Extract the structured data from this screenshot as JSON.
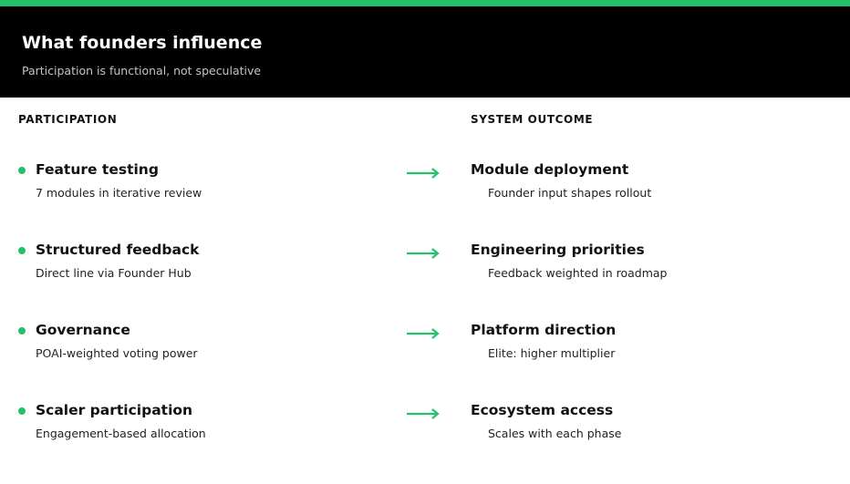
{
  "header": {
    "title": "What founders influence",
    "subtitle": "Participation is functional, not speculative"
  },
  "columns": {
    "left": "PARTICIPATION",
    "right": "SYSTEM OUTCOME"
  },
  "rows": [
    {
      "title": "Feature testing",
      "desc": "7 modules in iterative review",
      "outcome_title": "Module deployment",
      "outcome_desc": "Founder input shapes rollout"
    },
    {
      "title": "Structured feedback",
      "desc": "Direct line via Founder Hub",
      "outcome_title": "Engineering priorities",
      "outcome_desc": "Feedback weighted in roadmap"
    },
    {
      "title": "Governance",
      "desc": "POAI-weighted voting power",
      "outcome_title": "Platform direction",
      "outcome_desc": "Elite: higher multiplier"
    },
    {
      "title": "Scaler participation",
      "desc": "Engagement-based allocation",
      "outcome_title": "Ecosystem access",
      "outcome_desc": "Scales with each phase"
    }
  ],
  "colors": {
    "accent": "#23c16b",
    "header_bg": "#000000",
    "text": "#111111"
  },
  "icons": {
    "bullet": "dot-icon",
    "arrow": "arrow-right-icon"
  }
}
